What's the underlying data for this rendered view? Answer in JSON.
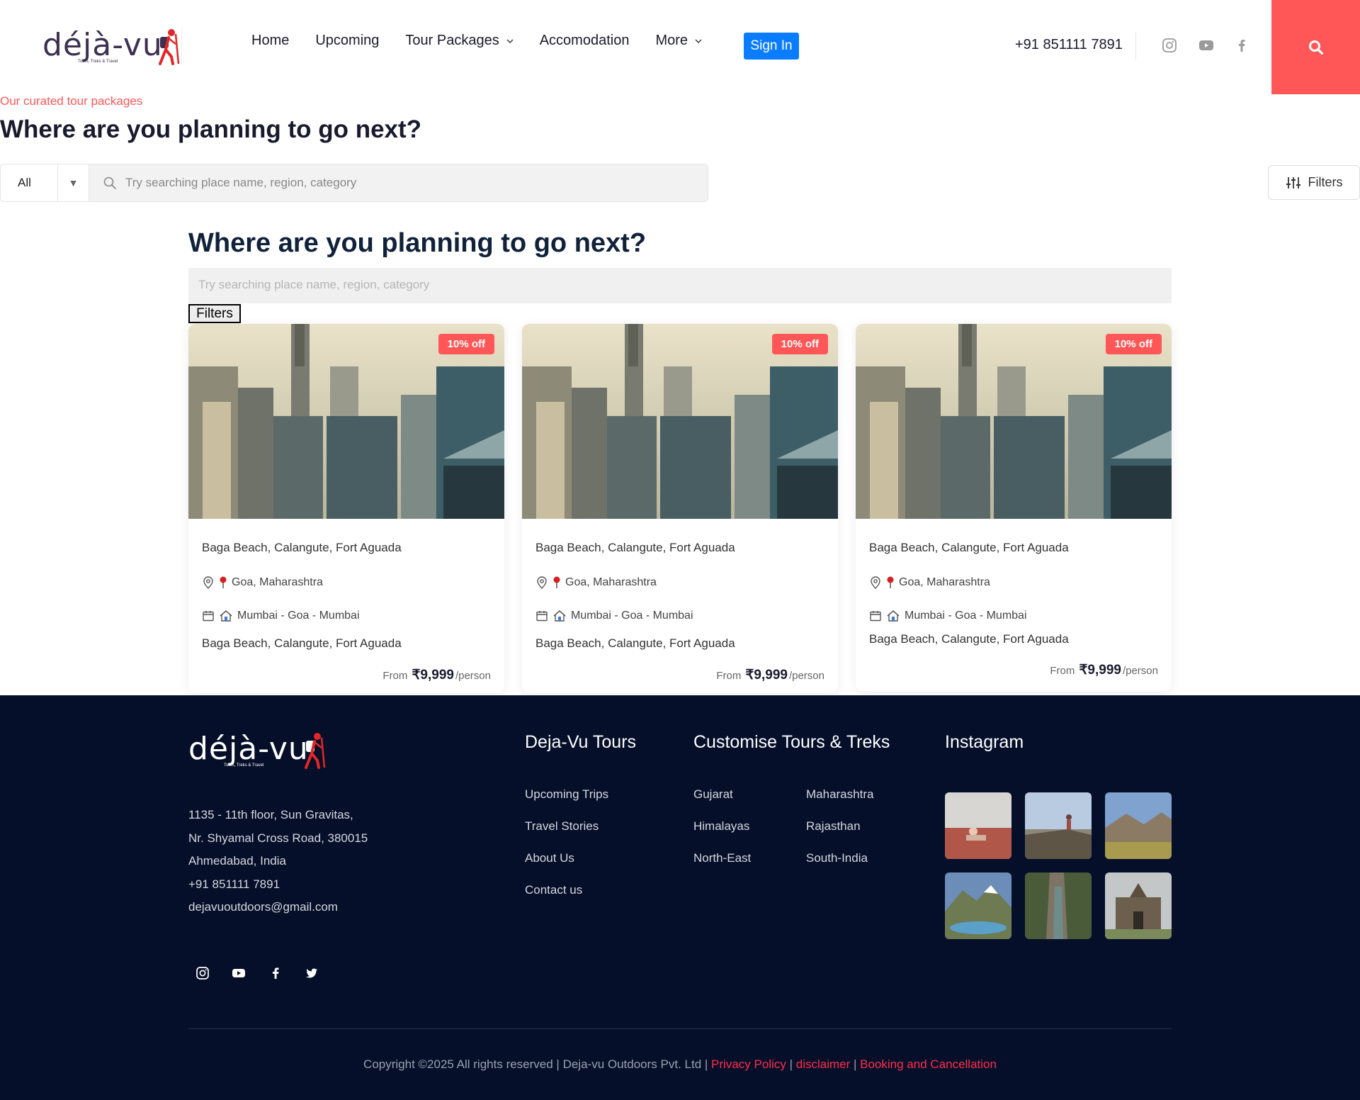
{
  "header": {
    "logo_text": "déjà-vu",
    "logo_tagline": "Tours, Treks & Travel",
    "nav": [
      {
        "label": "Home",
        "has_dropdown": false
      },
      {
        "label": "Upcoming",
        "has_dropdown": false
      },
      {
        "label": "Tour Packages",
        "has_dropdown": true
      },
      {
        "label": "Accomodation",
        "has_dropdown": false
      },
      {
        "label": "More",
        "has_dropdown": true
      }
    ],
    "signin_label": "Sign In",
    "phone": "+91 851111 7891",
    "social_icons": [
      "instagram-icon",
      "youtube-icon",
      "facebook-icon"
    ],
    "accent_color": "#ff5757",
    "signin_color": "#0a7cff"
  },
  "hero": {
    "eyebrow": "Our curated tour packages",
    "title": "Where are you planning to go next?",
    "category_value": "All",
    "search_placeholder": "Try searching place name, region, category",
    "filters_label": "Filters"
  },
  "listing": {
    "title": "Where are you planning to go next?",
    "search_placeholder": "Try searching place name, region, category",
    "filters_label": "Filters",
    "cards": [
      {
        "badge": "10% off",
        "title": "Baga Beach, Calangute, Fort Aguada",
        "location": "Goa, Maharashtra",
        "route": "Mumbai - Goa - Mumbai",
        "description": "Baga Beach, Calangute, Fort Aguada",
        "price_prefix": "From",
        "price": "₹9,999",
        "price_unit": "/person"
      },
      {
        "badge": "10% off",
        "title": "Baga Beach, Calangute, Fort Aguada",
        "location": "Goa, Maharashtra",
        "route": "Mumbai - Goa - Mumbai",
        "description": "Baga Beach, Calangute, Fort Aguada",
        "price_prefix": "From",
        "price": "₹9,999",
        "price_unit": "/person"
      },
      {
        "badge": "10% off",
        "title": "Baga Beach, Calangute, Fort Aguada",
        "location": "Goa, Maharashtra",
        "route": "Mumbai - Goa - Mumbai",
        "description": "Baga Beach, Calangute, Fort Aguada",
        "price_prefix": "From",
        "price": "₹9,999",
        "price_unit": "/person"
      }
    ]
  },
  "footer": {
    "address_lines": [
      "1135 - 11th floor, Sun Gravitas,",
      "Nr. Shyamal Cross Road, 380015",
      "Ahmedabad, India",
      "+91 851111 7891",
      "dejavuoutdoors@gmail.com"
    ],
    "social_icons": [
      "instagram-icon",
      "youtube-icon",
      "facebook-icon",
      "twitter-icon"
    ],
    "col1_title": "Deja-Vu Tours",
    "col1_links": [
      "Upcoming Trips",
      "Travel Stories",
      "About Us",
      "Contact us"
    ],
    "col2_title": "Customise Tours & Treks",
    "col2_links_left": [
      "Gujarat",
      "Himalayas",
      "North-East"
    ],
    "col2_links_right": [
      "Maharashtra",
      "Rajasthan",
      "South-India"
    ],
    "col3_title": "Instagram",
    "copyright_text": "Copyright ©2025 All rights reserved | Deja-vu Outdoors Pvt. Ltd |",
    "privacy_label": "Privacy Policy",
    "disclaimer_label": "disclaimer",
    "booking_label": "Booking and Cancellation",
    "background_color": "#050f2a"
  }
}
